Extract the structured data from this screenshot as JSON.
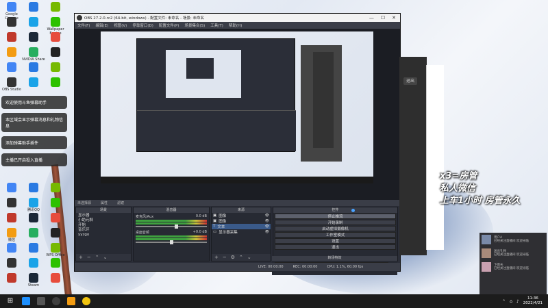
{
  "desktop": {
    "notes": [
      "欢迎使用斗鱼弹幕助手",
      "本区域会显示弹幕消息和礼物信息",
      "添加弹幕助手插件",
      "主播已开启投入直播"
    ],
    "big_text": [
      "x3=房管",
      "私人微信",
      "上车1小时 房管永久"
    ],
    "icon_labels": [
      "Google Chrome",
      "Wallpaper Engine",
      "NVIDIA Share",
      "OBS Studio",
      "腾讯QQ",
      "微信",
      "WPS Office",
      "Steam",
      "网易云音乐",
      "斗鱼直播",
      "YY开播",
      "Epic Games"
    ]
  },
  "obs": {
    "title": "OBS 27.2.0-rc2 (64-bit, windows) - 配置文件: 未命名 - 场景: 未命名",
    "menu": [
      "文件(F)",
      "编辑(E)",
      "视图(V)",
      "停靠窗口(D)",
      "配置文件(P)",
      "场景集合(S)",
      "工具(T)",
      "帮助(H)"
    ],
    "tabs": [
      "未选择源",
      "属性",
      "滤镜"
    ],
    "scenes": {
      "title": "场景",
      "items": [
        "显示器",
        "小助元斜",
        "开始",
        "音乐环",
        "yyzgo"
      ]
    },
    "mixer": {
      "title": "混音器",
      "channels": [
        {
          "name": "麦克风/Aux",
          "db": "0.0 dB",
          "level": 0.55
        },
        {
          "name": "桌面音频",
          "db": "+0.0 dB",
          "level": 0.48
        }
      ]
    },
    "sources": {
      "title": "来源",
      "items": [
        "图像",
        "图像",
        "文本",
        "显示器采集"
      ],
      "selected_index": 2
    },
    "controls": {
      "title": "控件",
      "buttons": [
        "停止推流",
        "开始录制",
        "启动虚拟摄像机",
        "工作室模式",
        "设置",
        "退出"
      ],
      "highlight_index": 0
    },
    "transitions": {
      "title": "转场特效",
      "type": "淡出",
      "duration_label": "时长",
      "duration": "300 ms"
    },
    "status": {
      "live": "LIVE: 00:00:00",
      "rec": "REC: 00:00:00",
      "cpu": "CPU: 1.1%, 60.00 fps"
    }
  },
  "right_panel": {
    "btn": "退出"
  },
  "chat": {
    "items": [
      {
        "name": "用户A",
        "msg": "已经关注直播间 欢迎光临"
      },
      {
        "name": "送出礼物",
        "msg": "已经关注直播间 欢迎光临"
      },
      {
        "name": "下雨天",
        "msg": "已经关注直播间 欢迎光临"
      }
    ]
  },
  "taskbar": {
    "time": "11:36",
    "date": "2022/4/21"
  }
}
